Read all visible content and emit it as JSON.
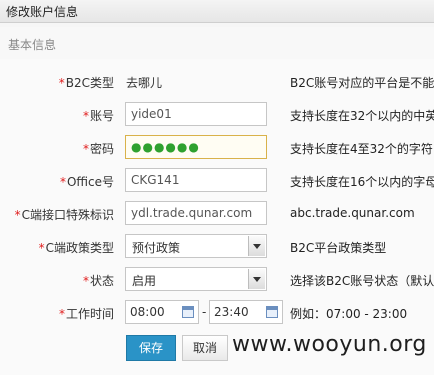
{
  "window": {
    "title": "修改账户信息"
  },
  "section": {
    "title": "基本信息"
  },
  "form": {
    "b2c_type": {
      "label": "B2C类型",
      "value": "去哪儿",
      "hint": "B2C账号对应的平台是不能"
    },
    "account": {
      "label": "账号",
      "value": "yide01",
      "hint": "支持长度在32个以内的中英"
    },
    "password": {
      "label": "密码",
      "value": "●●●●●●",
      "hint": "支持长度在4至32个的字符"
    },
    "office": {
      "label": "Office号",
      "value": "CKG141",
      "hint": "支持长度在16个以内的字母"
    },
    "c_code": {
      "label": "C端接口特殊标识",
      "value": "ydl.trade.qunar.com",
      "hint": "abc.trade.qunar.com"
    },
    "c_policy": {
      "label": "C端政策类型",
      "value": "预付政策",
      "hint": "B2C平台政策类型"
    },
    "status": {
      "label": "状态",
      "value": "启用",
      "hint": "选择该B2C账号状态（默认"
    },
    "work_time": {
      "label": "工作时间",
      "start": "08:00",
      "end": "23:40",
      "separator": "-",
      "hint": "例如：07:00 - 23:00"
    },
    "required_mark": "*"
  },
  "buttons": {
    "save": "保存",
    "cancel": "取消"
  },
  "watermark": "www.wooyun.org"
}
